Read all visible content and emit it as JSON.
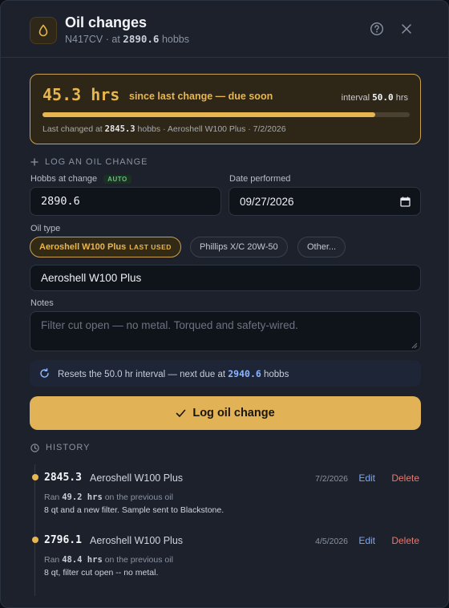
{
  "header": {
    "title": "Oil changes",
    "tail": "N417CV",
    "at_label": "at",
    "hobbs_current": "2890.6",
    "hobbs_unit": "hobbs",
    "help_icon": "help-circle-icon",
    "close_icon": "close-icon",
    "app_icon": "oil-drop-icon"
  },
  "status": {
    "hours_since": "45.3 hrs",
    "since_text": "since last change — due soon",
    "interval_label": "interval",
    "interval_value": "50.0",
    "interval_unit": "hrs",
    "progress_fraction": 0.906,
    "last_changed_prefix": "Last changed at",
    "last_changed_hobbs": "2845.3",
    "last_changed_suffix": "hobbs · Aeroshell W100 Plus · 7/2/2026",
    "accent_color": "#e8b650"
  },
  "form": {
    "section_title": "LOG AN OIL CHANGE",
    "hobbs_label": "Hobbs at change",
    "auto_badge": "AUTO",
    "hobbs_value": "2890.6",
    "date_label": "Date performed",
    "date_value": "09/27/2026",
    "oil_type_label": "Oil type",
    "oil_chips": [
      {
        "label": "Aeroshell W100 Plus",
        "tag": "LAST USED",
        "active": true
      },
      {
        "label": "Phillips X/C 20W-50",
        "tag": "",
        "active": false
      },
      {
        "label": "Other...",
        "tag": "",
        "active": false
      }
    ],
    "oil_value": "Aeroshell W100 Plus",
    "notes_label": "Notes",
    "notes_placeholder": "Filter cut open — no metal. Torqued and safety-wired.",
    "reset_prefix": "Resets the 50.0 hr interval — next due at",
    "next_due": "2940.6",
    "reset_suffix": "hobbs",
    "submit_label": "Log oil change"
  },
  "history": {
    "title": "HISTORY",
    "entries": [
      {
        "hobbs": "2845.3",
        "oil": "Aeroshell W100 Plus",
        "date": "7/2/2026",
        "ran_prefix": "Ran",
        "ran_hrs": "49.2 hrs",
        "ran_suffix": "on the previous oil",
        "note": "8 qt and a new filter. Sample sent to Blackstone.",
        "edit": "Edit",
        "delete": "Delete"
      },
      {
        "hobbs": "2796.1",
        "oil": "Aeroshell W100 Plus",
        "date": "4/5/2026",
        "ran_prefix": "Ran",
        "ran_hrs": "48.4 hrs",
        "ran_suffix": "on the previous oil",
        "note": "8 qt, filter cut open -- no metal.",
        "edit": "Edit",
        "delete": "Delete"
      }
    ]
  }
}
